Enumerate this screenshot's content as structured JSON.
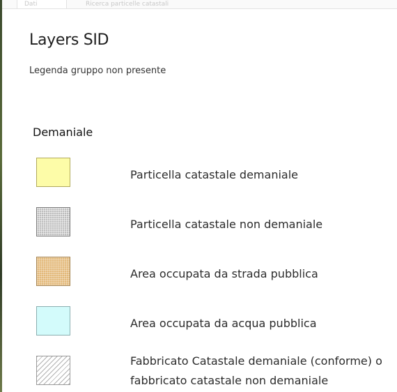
{
  "tabs": [
    {
      "label": "Dati"
    },
    {
      "label": "Ricerca particelle catastali"
    }
  ],
  "panel": {
    "title": "Layers SID",
    "subtitle": "Legenda gruppo non presente"
  },
  "group": {
    "title": "Demaniale",
    "items": [
      {
        "label": "Particella catastale demaniale",
        "icon": "yellow-swatch-icon",
        "color": "#fdfca8"
      },
      {
        "label": "Particella catastale non demaniale",
        "icon": "grey-grid-swatch-icon",
        "color": "#bdbdbd"
      },
      {
        "label": "Area occupata da strada pubblica",
        "icon": "tan-dotted-swatch-icon",
        "color": "#e3b97a"
      },
      {
        "label": "Area occupata da acqua pubblica",
        "icon": "light-cyan-swatch-icon",
        "color": "#d3fbfb"
      },
      {
        "label": "Fabbricato Catastale demaniale (conforme) o fabbricato catastale non demaniale",
        "icon": "hatched-swatch-icon",
        "color": "#ffffff"
      }
    ]
  }
}
